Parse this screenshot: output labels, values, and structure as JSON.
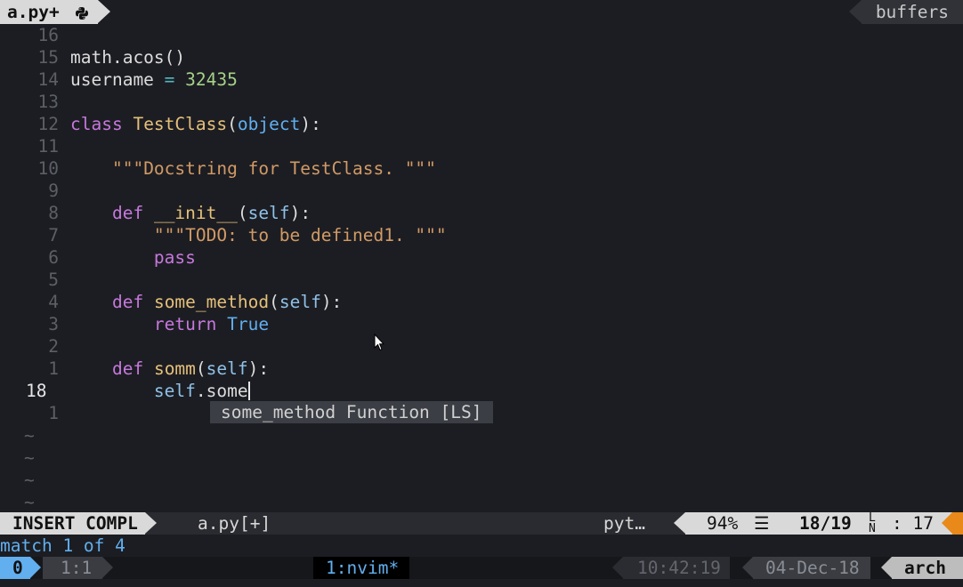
{
  "tabline": {
    "active_buffer": "a.py+",
    "filetype_icon": "python-icon",
    "buffers_label": "buffers"
  },
  "editor": {
    "lines": [
      {
        "num": "16"
      },
      {
        "num": "15",
        "parts": [
          [
            "plain",
            "math.acos()"
          ]
        ]
      },
      {
        "num": "14",
        "parts": [
          [
            "plain",
            "username "
          ],
          [
            "op",
            "="
          ],
          [
            "plain",
            " "
          ],
          [
            "num",
            "32435"
          ]
        ]
      },
      {
        "num": "13"
      },
      {
        "num": "12",
        "parts": [
          [
            "kw",
            "class"
          ],
          [
            "plain",
            " "
          ],
          [
            "fn",
            "TestClass"
          ],
          [
            "plain",
            "("
          ],
          [
            "bi",
            "object"
          ],
          [
            "plain",
            "):"
          ]
        ]
      },
      {
        "num": "11"
      },
      {
        "num": "10",
        "parts": [
          [
            "plain",
            "    "
          ],
          [
            "str",
            "\"\"\"Docstring for TestClass. \"\"\""
          ]
        ]
      },
      {
        "num": "9"
      },
      {
        "num": "8",
        "parts": [
          [
            "plain",
            "    "
          ],
          [
            "kw",
            "def"
          ],
          [
            "plain",
            " "
          ],
          [
            "fn",
            "__init__"
          ],
          [
            "plain",
            "("
          ],
          [
            "self",
            "self"
          ],
          [
            "plain",
            "):"
          ]
        ]
      },
      {
        "num": "7",
        "parts": [
          [
            "plain",
            "        "
          ],
          [
            "str",
            "\"\"\"TODO: to be defined1. \"\"\""
          ]
        ]
      },
      {
        "num": "6",
        "parts": [
          [
            "plain",
            "        "
          ],
          [
            "kw",
            "pass"
          ]
        ]
      },
      {
        "num": "5"
      },
      {
        "num": "4",
        "parts": [
          [
            "plain",
            "    "
          ],
          [
            "kw",
            "def"
          ],
          [
            "plain",
            " "
          ],
          [
            "fn",
            "some_method"
          ],
          [
            "plain",
            "("
          ],
          [
            "self",
            "self"
          ],
          [
            "plain",
            "):"
          ]
        ]
      },
      {
        "num": "3",
        "parts": [
          [
            "plain",
            "        "
          ],
          [
            "kw",
            "return"
          ],
          [
            "plain",
            " "
          ],
          [
            "bi",
            "True"
          ]
        ]
      },
      {
        "num": "2"
      },
      {
        "num": "1",
        "parts": [
          [
            "plain",
            "    "
          ],
          [
            "kw",
            "def"
          ],
          [
            "plain",
            " "
          ],
          [
            "fn",
            "somm"
          ],
          [
            "plain",
            "("
          ],
          [
            "self",
            "self"
          ],
          [
            "plain",
            "):"
          ]
        ]
      },
      {
        "num": "18",
        "current": true,
        "parts": [
          [
            "plain",
            "        "
          ],
          [
            "self",
            "self"
          ],
          [
            "plain",
            ".some"
          ]
        ]
      },
      {
        "num": "1"
      }
    ],
    "tildes": [
      "~",
      "~",
      "~",
      "~"
    ]
  },
  "completion_popup": {
    "item": "some_method Function [LS]"
  },
  "statusline": {
    "mode": "INSERT COMPL",
    "filename": "a.py[+]",
    "filetype": "pyt…",
    "percent": "94%",
    "percent_icon": "☰",
    "line_pos": "18/19",
    "line_icon": "ln-icon",
    "col_pos": ": 17"
  },
  "cmdline": {
    "message": "match 1 of 4"
  },
  "tmux": {
    "session": "0",
    "pane": "1:1",
    "window": "1:nvim*",
    "time": "10:42:19",
    "date": "04-Dec-18",
    "host": "arch"
  },
  "colors": {
    "background": "#1c1d22",
    "keyword": "#c678dd",
    "function": "#e5c07b",
    "builtin": "#61afef",
    "string": "#d19a66",
    "number": "#a6d189",
    "warning": "#e8891a"
  }
}
